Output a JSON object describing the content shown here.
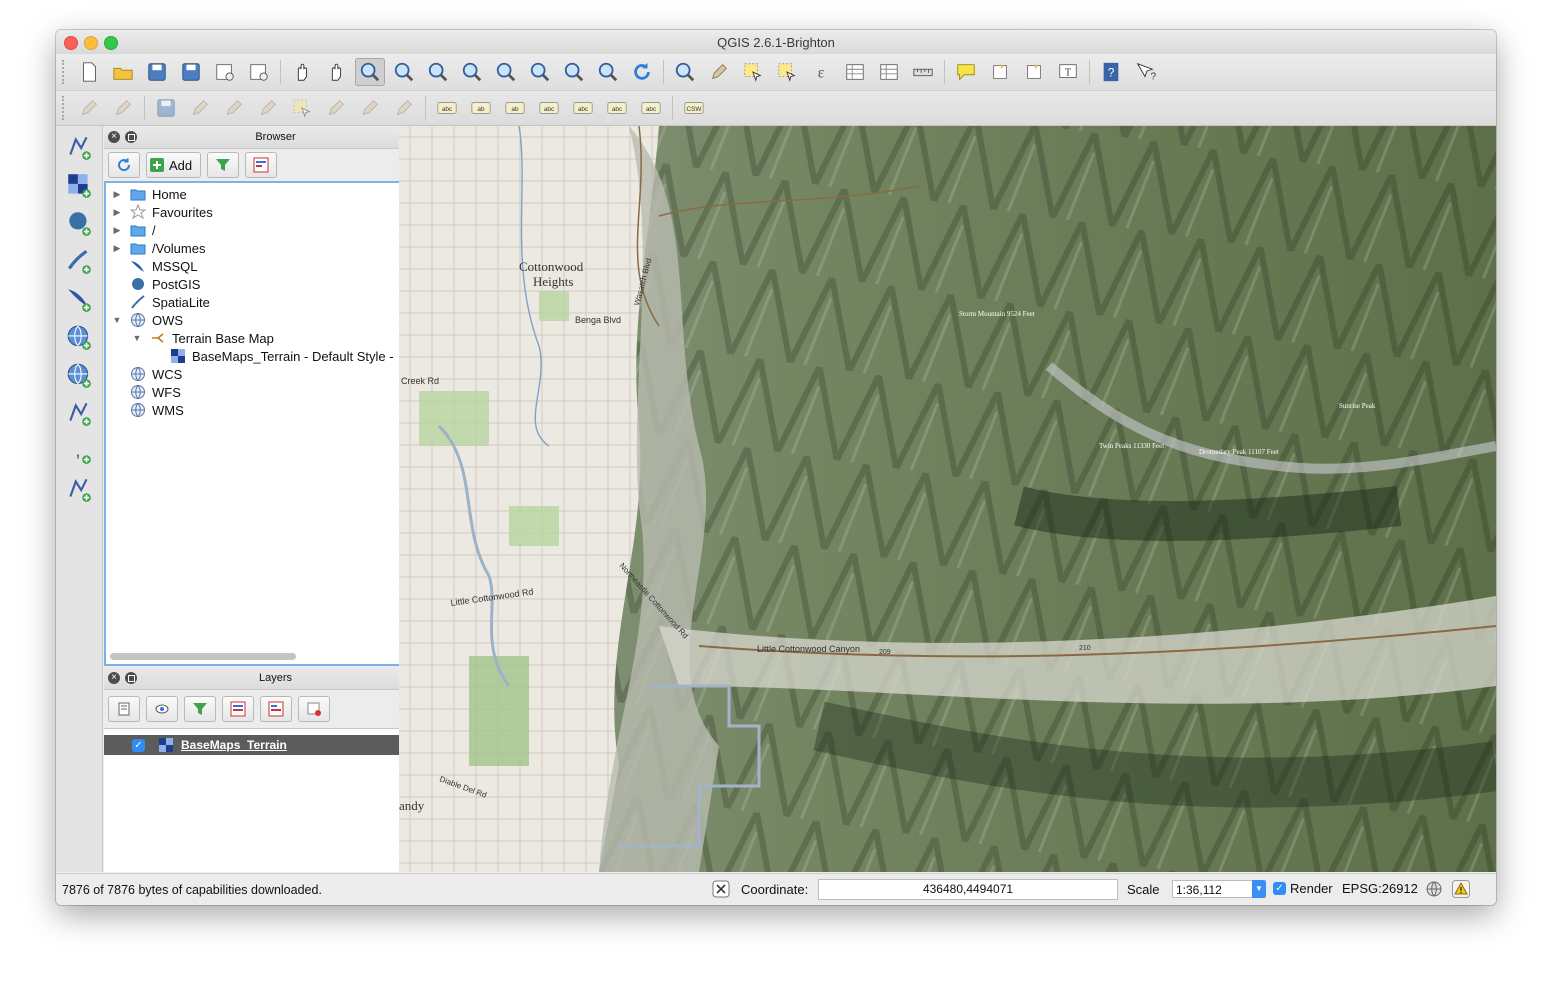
{
  "window": {
    "title": "QGIS 2.6.1-Brighton"
  },
  "toolbar_main": [
    {
      "icon": "new-project-icon"
    },
    {
      "icon": "open-project-icon"
    },
    {
      "icon": "save-project-icon"
    },
    {
      "icon": "save-as-icon"
    },
    {
      "icon": "new-print-composer-icon"
    },
    {
      "icon": "composer-manager-icon"
    },
    {
      "icon": "pan-icon"
    },
    {
      "icon": "pan-to-selection-icon"
    },
    {
      "icon": "zoom-in-icon"
    },
    {
      "icon": "zoom-out-icon"
    },
    {
      "icon": "zoom-actual-size-icon"
    },
    {
      "icon": "zoom-full-icon"
    },
    {
      "icon": "zoom-to-selection-icon"
    },
    {
      "icon": "zoom-to-layer-icon"
    },
    {
      "icon": "zoom-last-icon"
    },
    {
      "icon": "zoom-next-icon"
    },
    {
      "icon": "refresh-icon"
    },
    {
      "icon": "identify-icon"
    },
    {
      "icon": "run-feature-action-icon"
    },
    {
      "icon": "select-features-icon"
    },
    {
      "icon": "deselect-icon"
    },
    {
      "icon": "field-calculator-icon"
    },
    {
      "icon": "attribute-table-icon"
    },
    {
      "icon": "statistics-icon"
    },
    {
      "icon": "measure-icon"
    },
    {
      "icon": "map-tips-icon"
    },
    {
      "icon": "new-bookmark-icon"
    },
    {
      "icon": "show-bookmarks-icon"
    },
    {
      "icon": "text-annotation-icon"
    },
    {
      "icon": "help-contents-icon"
    },
    {
      "icon": "whats-this-icon"
    }
  ],
  "toolbar_secondary": [
    {
      "icon": "current-edits-icon"
    },
    {
      "icon": "toggle-editing-icon"
    },
    {
      "icon": "save-layer-edits-icon"
    },
    {
      "icon": "add-feature-icon"
    },
    {
      "icon": "move-feature-icon"
    },
    {
      "icon": "node-tool-icon"
    },
    {
      "icon": "delete-selected-icon"
    },
    {
      "icon": "cut-features-icon"
    },
    {
      "icon": "copy-features-icon"
    },
    {
      "icon": "paste-features-icon"
    },
    {
      "icon": "label-tool-icon",
      "text": "abc"
    },
    {
      "icon": "pin-labels-icon",
      "text": "ab"
    },
    {
      "icon": "show-hide-labels-icon",
      "text": "ab"
    },
    {
      "icon": "move-label-icon",
      "text": "abc"
    },
    {
      "icon": "rotate-label-icon",
      "text": "abc"
    },
    {
      "icon": "change-label-icon",
      "text": "abc"
    },
    {
      "icon": "label-properties-icon",
      "text": "abc"
    },
    {
      "icon": "csw-icon",
      "text": "CSW"
    }
  ],
  "left_toolbar": [
    {
      "icon": "add-vector-layer-icon"
    },
    {
      "icon": "add-raster-layer-icon"
    },
    {
      "icon": "add-postgis-layer-icon"
    },
    {
      "icon": "add-spatialite-layer-icon"
    },
    {
      "icon": "add-mssql-layer-icon"
    },
    {
      "icon": "add-wms-layer-icon"
    },
    {
      "icon": "add-wcs-layer-icon"
    },
    {
      "icon": "add-wfs-layer-icon"
    },
    {
      "icon": "add-delimited-text-icon"
    },
    {
      "icon": "new-shapefile-icon"
    }
  ],
  "browser": {
    "title": "Browser",
    "add_label": "Add",
    "items": [
      {
        "label": "Home",
        "indent": 0,
        "arrow": "▶",
        "icon": "folder-icon"
      },
      {
        "label": "Favourites",
        "indent": 0,
        "arrow": "▶",
        "icon": "star-icon"
      },
      {
        "label": "/",
        "indent": 0,
        "arrow": "▶",
        "icon": "folder-icon"
      },
      {
        "label": "/Volumes",
        "indent": 0,
        "arrow": "▶",
        "icon": "folder-icon"
      },
      {
        "label": "MSSQL",
        "indent": 0,
        "arrow": "",
        "icon": "mssql-icon"
      },
      {
        "label": "PostGIS",
        "indent": 0,
        "arrow": "",
        "icon": "postgis-icon"
      },
      {
        "label": "SpatiaLite",
        "indent": 0,
        "arrow": "",
        "icon": "spatialite-icon"
      },
      {
        "label": "OWS",
        "indent": 0,
        "arrow": "▼",
        "icon": "globe-icon"
      },
      {
        "label": "Terrain Base Map",
        "indent": 1,
        "arrow": "▼",
        "icon": "connection-icon"
      },
      {
        "label": "BaseMaps_Terrain - Default Style -",
        "indent": 2,
        "arrow": "",
        "icon": "raster-icon"
      },
      {
        "label": "WCS",
        "indent": 0,
        "arrow": "",
        "icon": "globe-icon"
      },
      {
        "label": "WFS",
        "indent": 0,
        "arrow": "",
        "icon": "globe-icon"
      },
      {
        "label": "WMS",
        "indent": 0,
        "arrow": "",
        "icon": "globe-icon"
      }
    ]
  },
  "layers": {
    "title": "Layers",
    "items": [
      {
        "name": "BaseMaps_Terrain",
        "checked": true
      }
    ]
  },
  "map_labels": {
    "cottonwood": "Cottonwood",
    "heights": "Heights",
    "benga_blvd": "Benga Blvd",
    "creek_rd": "Creek Rd",
    "little_cottonwood_rd": "Little Cottonwood Rd",
    "little_cottonwood_canyon": "Little Cottonwood Canyon",
    "ne_little_cottonwood_rd": "Northeastle Cottonwood Rd",
    "wasatch": "Wasatch Blvd",
    "diable_del_rd": "Diable Del Rd",
    "sandy": "andy",
    "twin_peaks": "Twin Peaks 11330 Feet",
    "dromedary": "Dromedary Peak 11107 Feet",
    "sunrise_peak": "Sunrise Peak",
    "storm_mountain": "Storm Mountain 9524 Feet",
    "road_209": "209",
    "road_210": "210"
  },
  "status": {
    "message": "7876 of 7876 bytes of capabilities downloaded.",
    "coordinate_label": "Coordinate:",
    "coordinate_value": "436480,4494071",
    "scale_label": "Scale",
    "scale_value": "1:36,112",
    "render_label": "Render",
    "render_checked": true,
    "crs": "EPSG:26912"
  }
}
